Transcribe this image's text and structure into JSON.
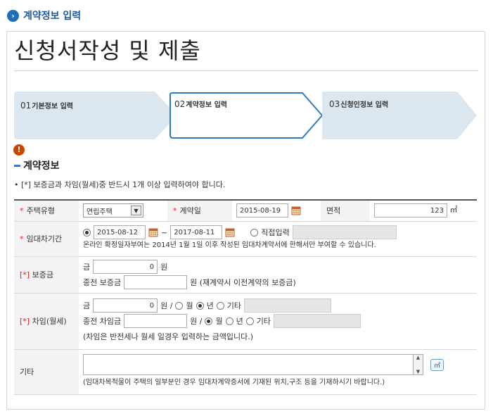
{
  "header": {
    "title": "계약정보 입력"
  },
  "page_title": "신청서작성 및 제출",
  "steps": [
    {
      "num": "01",
      "label": "기본정보 입력"
    },
    {
      "num": "02",
      "label": "계약정보 입력"
    },
    {
      "num": "03",
      "label": "신청인정보 입력"
    }
  ],
  "section": {
    "alert_glyph": "!",
    "title": "계약정보",
    "notice": "• [*] 보증금과 차임(월세)중 반드시 1개 이상 입력하여야 합니다."
  },
  "form": {
    "housing_type": {
      "label": "주택유형",
      "value": "연립주택"
    },
    "contract_date": {
      "label": "계약일",
      "value": "2015-08-19"
    },
    "area": {
      "label": "면적",
      "value": "123",
      "unit": "㎡"
    },
    "lease_period": {
      "label": "임대차기간",
      "start": "2015-08-12",
      "tilde": "~",
      "end": "2017-08-11",
      "direct_label": "직접입력",
      "note": "온라인 확정일자부여는 2014년 1월 1일 이후 작성된 임대차계약서에 한해서만 부여할 수 있습니다."
    },
    "deposit": {
      "label": "보증금",
      "bracket": "[*]",
      "amount_label": "금",
      "amount": "0",
      "won": "원",
      "prev_label": "종전 보증금",
      "prev_unit": "원 (재계약시 이전계약의 보증금)"
    },
    "rent": {
      "label": "차임(월세)",
      "bracket": "[*]",
      "amount_label": "금",
      "amount": "0",
      "won_slash": "원 /",
      "period_month": "월",
      "period_year": "년",
      "period_other": "기타",
      "prev_label": "종전 차임금",
      "note": "(차임은 반전세나 월세 일경우 입력하는 금액입니다.)"
    },
    "etc": {
      "label": "기타",
      "unit_button": "㎡",
      "note": "(임대차목적물이 주택의 일부분인 경우 임대차계약증서에 기재된 위치,구조 등을 기재하시기 바랍니다.)"
    }
  }
}
